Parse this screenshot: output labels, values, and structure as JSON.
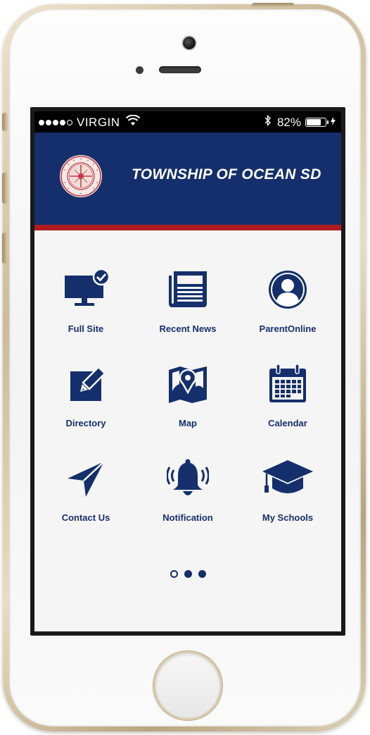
{
  "status_bar": {
    "carrier": "VIRGIN",
    "battery_percent": "82%",
    "battery_level": 0.82
  },
  "header": {
    "title": "TOWNSHIP OF OCEAN SD",
    "seal_text_top": "TOWNSHIP OF OCEAN SCHOOLS",
    "seal_text_bottom": "OCEAN, NEW JERSEY"
  },
  "tiles": [
    {
      "label": "Full Site",
      "icon": "monitor-check-icon"
    },
    {
      "label": "Recent News",
      "icon": "newspaper-icon"
    },
    {
      "label": "ParentOnline",
      "icon": "person-icon"
    },
    {
      "label": "Directory",
      "icon": "edit-icon"
    },
    {
      "label": "Map",
      "icon": "map-pin-icon"
    },
    {
      "label": "Calendar",
      "icon": "calendar-icon"
    },
    {
      "label": "Contact Us",
      "icon": "paper-plane-icon"
    },
    {
      "label": "Notification",
      "icon": "bell-icon"
    },
    {
      "label": "My Schools",
      "icon": "graduation-cap-icon"
    }
  ],
  "pager": {
    "pages": 3,
    "active_index": 0
  },
  "colors": {
    "brand_navy": "#142f6b",
    "accent_red": "#b11a21",
    "background": "#f6f5f5"
  }
}
